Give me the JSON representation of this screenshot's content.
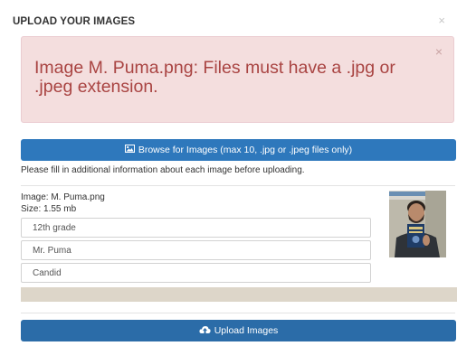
{
  "modal": {
    "title": "UPLOAD YOUR IMAGES",
    "close_icon": "close-icon"
  },
  "alert": {
    "message": "Image M. Puma.png: Files must have a .jpg or .jpeg extension.",
    "close_icon": "close-icon",
    "color": "#a94442",
    "background": "#f4dede"
  },
  "browse": {
    "icon": "image-icon",
    "label": "Browse for Images (max 10, .jpg or .jpeg files only)"
  },
  "instructions": "Please fill in additional information about each image before uploading.",
  "image": {
    "name_label": "Image: M. Puma.png",
    "size_label": "Size: 1.55 mb",
    "fields": [
      {
        "value": "12th grade"
      },
      {
        "value": "Mr. Puma"
      },
      {
        "value": "Candid"
      }
    ],
    "thumbnail_icon": "photo-thumbnail",
    "progress_fraction": 0
  },
  "upload": {
    "icon": "cloud-upload-icon",
    "label": "Upload Images"
  },
  "colors": {
    "primary": "#2e78bc",
    "upload_button": "#2b6ca8"
  }
}
